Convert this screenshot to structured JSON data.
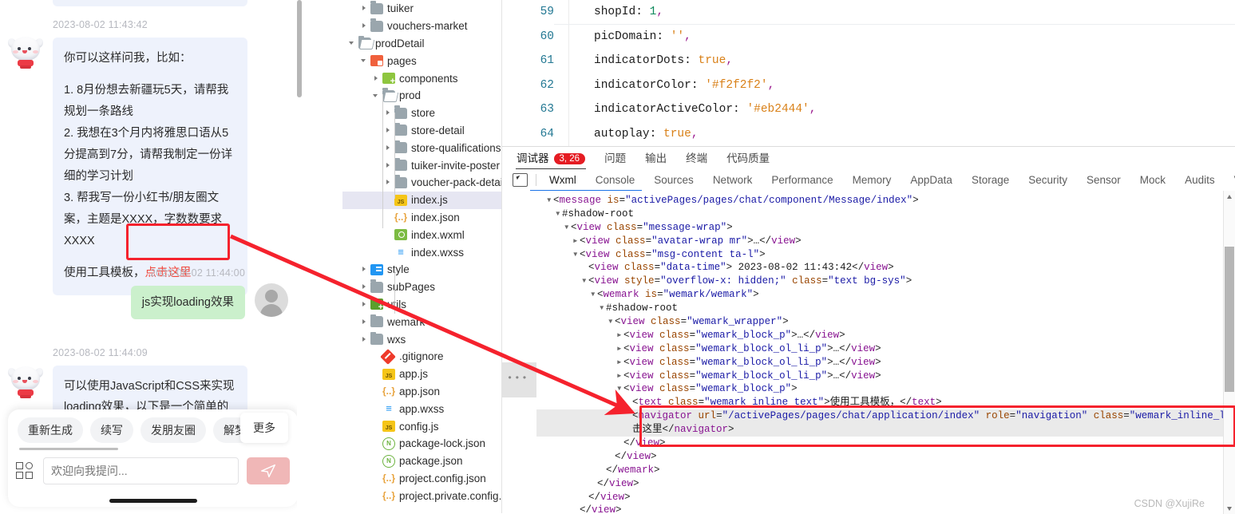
{
  "chat": {
    "messages": [
      {
        "time": "2023-08-02 11:43:42",
        "sender": "bot",
        "lines": [
          "你可以这样问我，比如：",
          "1. 8月份想去新疆玩5天，请帮我规划一条路线",
          "2. 我想在3个月内将雅思口语从5分提高到7分，请帮我制定一份详细的学习计划",
          "3. 帮我写一份小红书/朋友圈文案，主题是XXXX，字数数要求XXXX",
          "使用工具模板，"
        ],
        "link_text": "点击这里"
      },
      {
        "time": "2023-08-02 11:44:00",
        "sender": "user",
        "text": "js实现loading效果"
      },
      {
        "time": "2023-08-02 11:44:09",
        "sender": "bot",
        "text_line1": "可以使用JavaScript和CSS来实现",
        "text_line2": "loading效果，以下是一个简单的示"
      }
    ],
    "quick_actions": [
      "重新生成",
      "续写",
      "发朋友圈",
      "解梦小"
    ],
    "more_label": "更多",
    "input_placeholder": "欢迎向我提问...",
    "send_icon": "send-icon",
    "grid_icon": "grid-menu-icon"
  },
  "file_tree": [
    {
      "label": "tuiker",
      "indent": 1,
      "arrow": "closed",
      "icon": "folder",
      "selected": false
    },
    {
      "label": "vouchers-market",
      "indent": 1,
      "arrow": "closed",
      "icon": "folder",
      "selected": false
    },
    {
      "label": "prodDetail",
      "indent": 0,
      "arrow": "open",
      "icon": "folder-open",
      "selected": false
    },
    {
      "label": "pages",
      "indent": 1,
      "arrow": "open",
      "icon": "pages",
      "selected": false
    },
    {
      "label": "components",
      "indent": 2,
      "arrow": "closed",
      "icon": "components",
      "selected": false
    },
    {
      "label": "prod",
      "indent": 2,
      "arrow": "open",
      "icon": "folder-open",
      "selected": false
    },
    {
      "label": "store",
      "indent": 3,
      "arrow": "closed",
      "icon": "folder",
      "selected": false
    },
    {
      "label": "store-detail",
      "indent": 3,
      "arrow": "closed",
      "icon": "folder",
      "selected": false
    },
    {
      "label": "store-qualifications",
      "indent": 3,
      "arrow": "closed",
      "icon": "folder",
      "selected": false
    },
    {
      "label": "tuiker-invite-poster",
      "indent": 3,
      "arrow": "closed",
      "icon": "folder",
      "selected": false
    },
    {
      "label": "voucher-pack-detail",
      "indent": 3,
      "arrow": "closed",
      "icon": "folder",
      "selected": false
    },
    {
      "label": "index.js",
      "indent": 3,
      "arrow": "none",
      "icon": "js",
      "selected": true
    },
    {
      "label": "index.json",
      "indent": 3,
      "arrow": "none",
      "icon": "json",
      "selected": false
    },
    {
      "label": "index.wxml",
      "indent": 3,
      "arrow": "none",
      "icon": "wxml",
      "selected": false
    },
    {
      "label": "index.wxss",
      "indent": 3,
      "arrow": "none",
      "icon": "wxss",
      "selected": false
    },
    {
      "label": "style",
      "indent": 1,
      "arrow": "closed",
      "icon": "style",
      "selected": false
    },
    {
      "label": "subPages",
      "indent": 1,
      "arrow": "closed",
      "icon": "folder",
      "selected": false
    },
    {
      "label": "utils",
      "indent": 1,
      "arrow": "closed",
      "icon": "utils",
      "selected": false
    },
    {
      "label": "wemark",
      "indent": 1,
      "arrow": "closed",
      "icon": "folder",
      "selected": false
    },
    {
      "label": "wxs",
      "indent": 1,
      "arrow": "closed",
      "icon": "folder",
      "selected": false
    },
    {
      "label": ".gitignore",
      "indent": 2,
      "arrow": "none",
      "icon": "git",
      "selected": false
    },
    {
      "label": "app.js",
      "indent": 2,
      "arrow": "none",
      "icon": "js",
      "selected": false
    },
    {
      "label": "app.json",
      "indent": 2,
      "arrow": "none",
      "icon": "json",
      "selected": false
    },
    {
      "label": "app.wxss",
      "indent": 2,
      "arrow": "none",
      "icon": "wxss",
      "selected": false
    },
    {
      "label": "config.js",
      "indent": 2,
      "arrow": "none",
      "icon": "js",
      "selected": false
    },
    {
      "label": "package-lock.json",
      "indent": 2,
      "arrow": "none",
      "icon": "npm",
      "selected": false
    },
    {
      "label": "package.json",
      "indent": 2,
      "arrow": "none",
      "icon": "npm",
      "selected": false
    },
    {
      "label": "project.config.json",
      "indent": 2,
      "arrow": "none",
      "icon": "json",
      "selected": false
    },
    {
      "label": "project.private.config.js...",
      "indent": 2,
      "arrow": "none",
      "icon": "json",
      "selected": false
    }
  ],
  "editor": {
    "lines": [
      {
        "num": "59",
        "key": "shopId",
        "value": "1",
        "kind": "num",
        "comma": ","
      },
      {
        "num": "60",
        "key": "picDomain",
        "value": "''",
        "kind": "str",
        "comma": ","
      },
      {
        "num": "61",
        "key": "indicatorDots",
        "value": "true",
        "kind": "bool",
        "comma": ","
      },
      {
        "num": "62",
        "key": "indicatorColor",
        "value": "'#f2f2f2'",
        "kind": "str",
        "comma": ","
      },
      {
        "num": "63",
        "key": "indicatorActiveColor",
        "value": "'#eb2444'",
        "kind": "str",
        "comma": ","
      },
      {
        "num": "64",
        "key": "autoplay",
        "value": "true",
        "kind": "bool",
        "comma": ","
      }
    ]
  },
  "devtools": {
    "primary_tabs": [
      {
        "label": "调试器",
        "badge": "3, 26",
        "active": true
      },
      {
        "label": "问题",
        "badge": "",
        "active": false
      },
      {
        "label": "输出",
        "badge": "",
        "active": false
      },
      {
        "label": "终端",
        "badge": "",
        "active": false
      },
      {
        "label": "代码质量",
        "badge": "",
        "active": false
      }
    ],
    "secondary_tabs": [
      {
        "label": "Wxml",
        "active": true
      },
      {
        "label": "Console",
        "active": false
      },
      {
        "label": "Sources",
        "active": false
      },
      {
        "label": "Network",
        "active": false
      },
      {
        "label": "Performance",
        "active": false
      },
      {
        "label": "Memory",
        "active": false
      },
      {
        "label": "AppData",
        "active": false
      },
      {
        "label": "Storage",
        "active": false
      },
      {
        "label": "Security",
        "active": false
      },
      {
        "label": "Sensor",
        "active": false
      },
      {
        "label": "Mock",
        "active": false
      },
      {
        "label": "Audits",
        "active": false
      },
      {
        "label": "Vulnerability",
        "active": false
      }
    ],
    "inspect_icon": "element-picker-icon",
    "ellipsis": "•••",
    "dom_rows": [
      {
        "indent": 0,
        "tri": "open",
        "html": "&lt;<span class=\"tag\">message</span> <span class=\"attr\">is</span>=<span class=\"val\">\"activePages/pages/chat/component/Message/index\"</span>&gt;"
      },
      {
        "indent": 1,
        "tri": "open",
        "html": "<span class=\"shadow-lbl\">#shadow-root</span>"
      },
      {
        "indent": 2,
        "tri": "open",
        "html": "&lt;<span class=\"tag\">view</span> <span class=\"attr\">class</span>=<span class=\"val\">\"message-wrap\"</span>&gt;"
      },
      {
        "indent": 3,
        "tri": "closed",
        "html": "&lt;<span class=\"tag\">view</span> <span class=\"attr\">class</span>=<span class=\"val\">\"avatar-wrap mr\"</span>&gt;…&lt;/<span class=\"tag\">view</span>&gt;"
      },
      {
        "indent": 3,
        "tri": "open",
        "html": "&lt;<span class=\"tag\">view</span> <span class=\"attr\">class</span>=<span class=\"val\">\"msg-content ta-l\"</span>&gt;"
      },
      {
        "indent": 4,
        "tri": "none",
        "html": "&lt;<span class=\"tag\">view</span> <span class=\"attr\">class</span>=<span class=\"val\">\"data-time\"</span>&gt; <span class=\"txt\">2023-08-02 11:43:42</span>&lt;/<span class=\"tag\">view</span>&gt;"
      },
      {
        "indent": 4,
        "tri": "open",
        "html": "&lt;<span class=\"tag\">view</span> <span class=\"attr\">style</span>=<span class=\"val\">\"overflow-x: hidden;\"</span> <span class=\"attr\">class</span>=<span class=\"val\">\"text bg-sys\"</span>&gt;"
      },
      {
        "indent": 5,
        "tri": "open",
        "html": "&lt;<span class=\"tag\">wemark</span> <span class=\"attr\">is</span>=<span class=\"val\">\"wemark/wemark\"</span>&gt;"
      },
      {
        "indent": 6,
        "tri": "open",
        "html": "<span class=\"shadow-lbl\">#shadow-root</span>"
      },
      {
        "indent": 7,
        "tri": "open",
        "html": "&lt;<span class=\"tag\">view</span> <span class=\"attr\">class</span>=<span class=\"val\">\"wemark_wrapper\"</span>&gt;"
      },
      {
        "indent": 8,
        "tri": "closed",
        "html": "&lt;<span class=\"tag\">view</span> <span class=\"attr\">class</span>=<span class=\"val\">\"wemark_block_p\"</span>&gt;…&lt;/<span class=\"tag\">view</span>&gt;"
      },
      {
        "indent": 8,
        "tri": "closed",
        "html": "&lt;<span class=\"tag\">view</span> <span class=\"attr\">class</span>=<span class=\"val\">\"wemark_block_ol_li_p\"</span>&gt;…&lt;/<span class=\"tag\">view</span>&gt;"
      },
      {
        "indent": 8,
        "tri": "closed",
        "html": "&lt;<span class=\"tag\">view</span> <span class=\"attr\">class</span>=<span class=\"val\">\"wemark_block_ol_li_p\"</span>&gt;…&lt;/<span class=\"tag\">view</span>&gt;"
      },
      {
        "indent": 8,
        "tri": "closed",
        "html": "&lt;<span class=\"tag\">view</span> <span class=\"attr\">class</span>=<span class=\"val\">\"wemark_block_ol_li_p\"</span>&gt;…&lt;/<span class=\"tag\">view</span>&gt;"
      },
      {
        "indent": 8,
        "tri": "open",
        "html": "&lt;<span class=\"tag\">view</span> <span class=\"attr\">class</span>=<span class=\"val\">\"wemark_block_p\"</span>&gt;"
      },
      {
        "indent": 9,
        "tri": "none",
        "html": "&lt;<span class=\"tag\">text</span> <span class=\"attr\">class</span>=<span class=\"val\">\"wemark_inline_text\"</span>&gt;<span class=\"txt\">使用工具模板，</span>&lt;/<span class=\"tag\">text</span>&gt;"
      },
      {
        "indent": 9,
        "tri": "none",
        "hl": true,
        "html": "&lt;<span class=\"tag\">navigator</span> <span class=\"attr\">url</span>=<span class=\"val\">\"/activePages/pages/chat/application/index\"</span> <span class=\"attr\">role</span>=<span class=\"val\">\"navigation\"</span> <span class=\"attr\">class</span>=<span class=\"val\">\"wemark_inline_link\"</span>&gt;<span class=\"txt\">点</span>"
      },
      {
        "indent": 9,
        "tri": "none",
        "hl": true,
        "html": "<span class=\"txt\">击这里</span>&lt;/<span class=\"tag\">navigator</span>&gt;"
      },
      {
        "indent": 8,
        "tri": "none",
        "html": "&lt;/<span class=\"tag\">view</span>&gt;"
      },
      {
        "indent": 7,
        "tri": "none",
        "html": "&lt;/<span class=\"tag\">view</span>&gt;"
      },
      {
        "indent": 6,
        "tri": "none",
        "html": "&lt;/<span class=\"tag\">wemark</span>&gt;"
      },
      {
        "indent": 5,
        "tri": "none",
        "html": "&lt;/<span class=\"tag\">view</span>&gt;"
      },
      {
        "indent": 4,
        "tri": "none",
        "html": "&lt;/<span class=\"tag\">view</span>&gt;"
      },
      {
        "indent": 3,
        "tri": "none",
        "html": "&lt;/<span class=\"tag\">view</span>&gt;"
      }
    ]
  },
  "watermark": "CSDN @XujiRe",
  "colors": {
    "accent_red": "#f5222d",
    "badge_red": "#e51c23",
    "link_red": "#f0453a",
    "bubble_sys": "#eef2fc",
    "bubble_me": "#cbf0cc",
    "selected_row": "#e6e6f2",
    "devtools_active": "#1a73e8"
  }
}
